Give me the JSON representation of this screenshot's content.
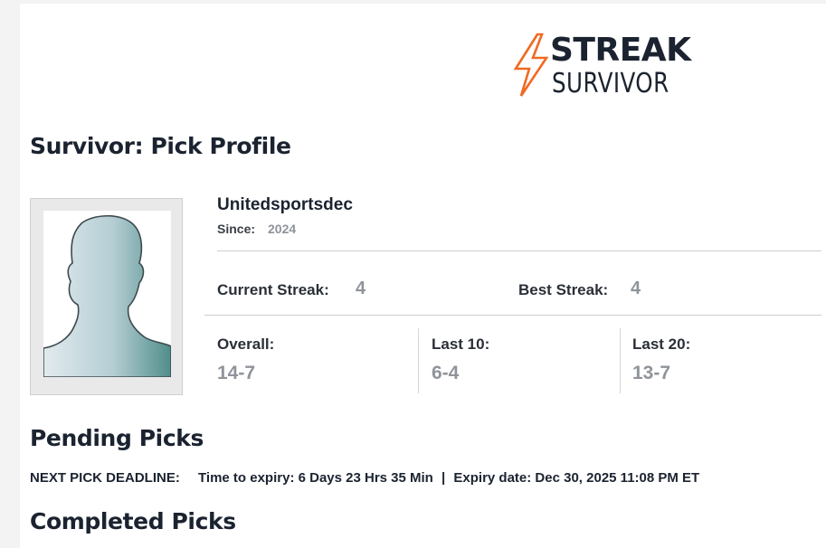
{
  "logo": {
    "line1": "STREAK",
    "line2": "SURVIVOR",
    "accent": "#f06a22"
  },
  "page_title": "Survivor: Pick Profile",
  "profile": {
    "username": "Unitedsportsdec",
    "since_label": "Since:",
    "since_value": "2024"
  },
  "streaks": {
    "current_label": "Current Streak:",
    "current_value": "4",
    "best_label": "Best Streak:",
    "best_value": "4"
  },
  "records": {
    "overall_label": "Overall:",
    "overall_value": "14-7",
    "last10_label": "Last 10:",
    "last10_value": "6-4",
    "last20_label": "Last 20:",
    "last20_value": "13-7"
  },
  "pending": {
    "heading": "Pending Picks",
    "deadline_label": "NEXT PICK DEADLINE:",
    "time_to_expiry": "Time to expiry: 6 Days 23 Hrs 35 Min",
    "separator": "|",
    "expiry_date": "Expiry date: Dec 30, 2025 11:08 PM ET"
  },
  "completed": {
    "heading": "Completed Picks"
  },
  "icons": {
    "logo_mark": "lightning-bolt-icon",
    "avatar": "silhouette-avatar-icon"
  }
}
